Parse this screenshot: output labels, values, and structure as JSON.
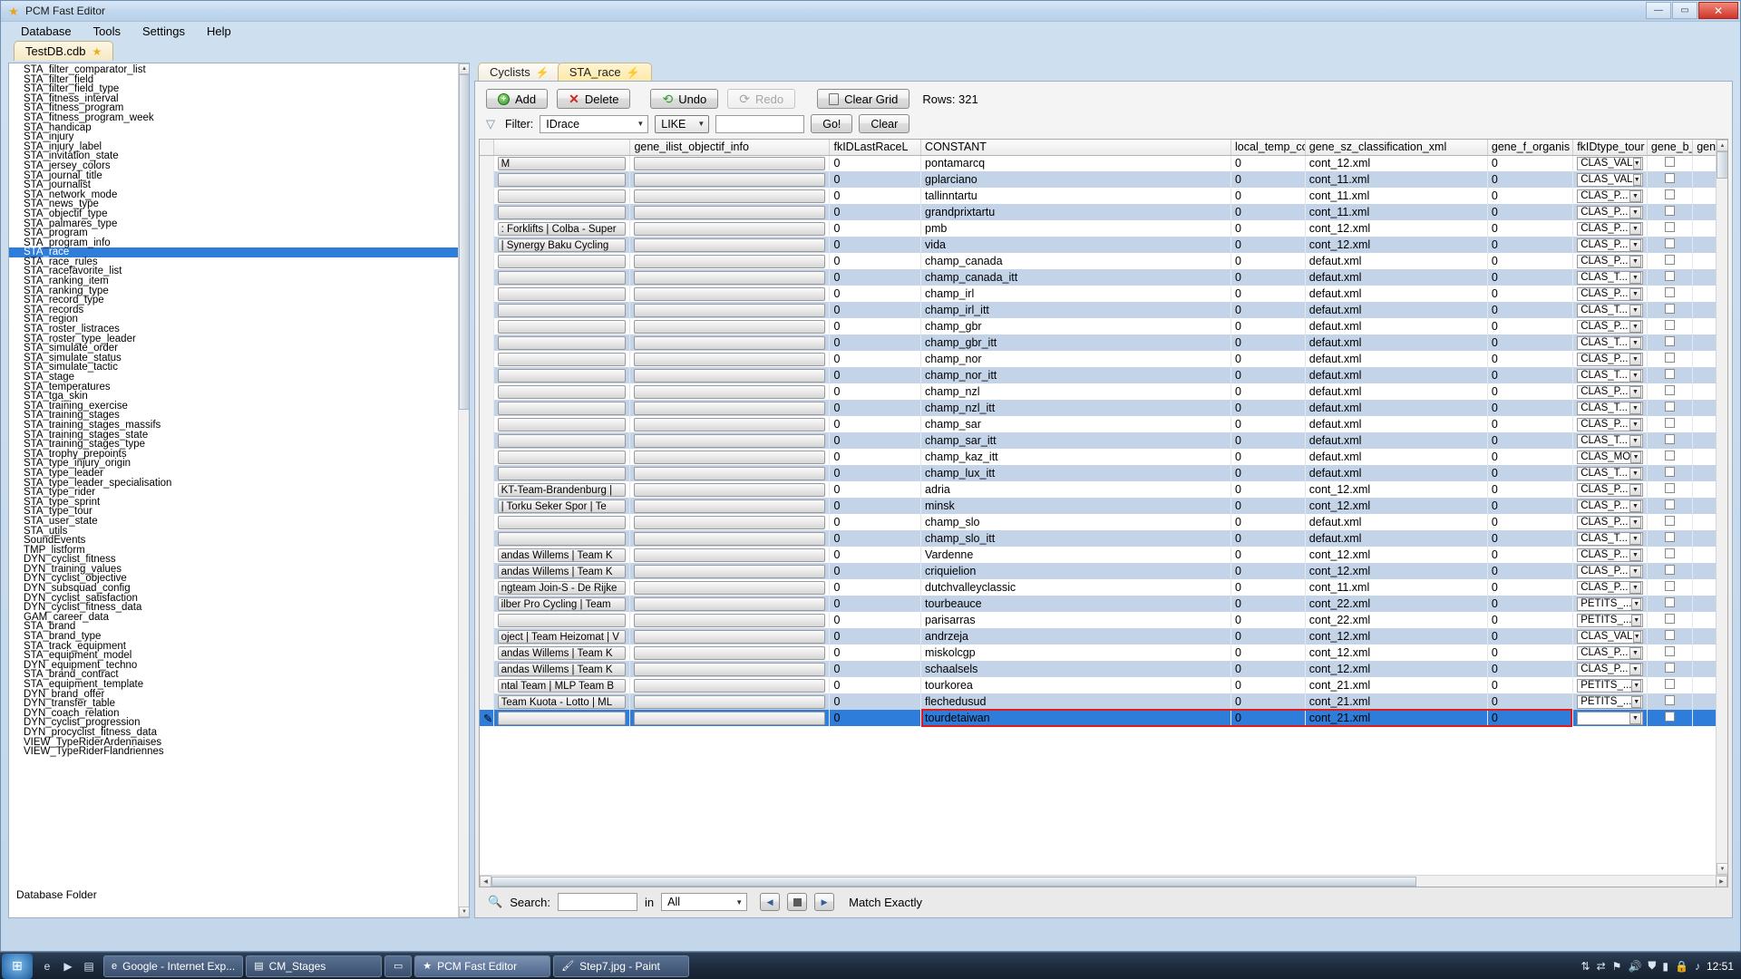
{
  "window": {
    "title": "PCM Fast Editor",
    "icon": "star-icon",
    "minimize": "—",
    "maximize": "▭",
    "close": "✕"
  },
  "menu": [
    "Database",
    "Tools",
    "Settings",
    "Help"
  ],
  "doc_tab": {
    "label": "TestDB.cdb",
    "icon": "star-icon"
  },
  "sidebar": {
    "items": [
      "STA_filter_comparator_list",
      "STA_filter_field",
      "STA_filter_field_type",
      "STA_fitness_interval",
      "STA_fitness_program",
      "STA_fitness_program_week",
      "STA_handicap",
      "STA_injury",
      "STA_injury_label",
      "STA_invitation_state",
      "STA_jersey_colors",
      "STA_journal_title",
      "STA_journalist",
      "STA_network_mode",
      "STA_news_type",
      "STA_objectif_type",
      "STA_palmares_type",
      "STA_program",
      "STA_program_info",
      "STA_race",
      "STA_race_rules",
      "STA_racefavorite_list",
      "STA_ranking_item",
      "STA_ranking_type",
      "STA_record_type",
      "STA_records",
      "STA_region",
      "STA_roster_listraces",
      "STA_roster_type_leader",
      "STA_simulate_order",
      "STA_simulate_status",
      "STA_simulate_tactic",
      "STA_stage",
      "STA_temperatures",
      "STA_tga_skin",
      "STA_training_exercise",
      "STA_training_stages",
      "STA_training_stages_massifs",
      "STA_training_stages_state",
      "STA_training_stages_type",
      "STA_trophy_prepoints",
      "STA_type_injury_origin",
      "STA_type_leader",
      "STA_type_leader_specialisation",
      "STA_type_rider",
      "STA_type_sprint",
      "STA_type_tour",
      "STA_user_state",
      "STA_utils",
      "SoundEvents",
      "TMP_listform",
      "DYN_cyclist_fitness",
      "DYN_training_values",
      "DYN_cyclist_objective",
      "DYN_subsquad_config",
      "DYN_cyclist_satisfaction",
      "DYN_cyclist_fitness_data",
      "GAM_career_data",
      "STA_brand",
      "STA_brand_type",
      "STA_track_equipment",
      "STA_equipment_model",
      "DYN_equipment_techno",
      "STA_brand_contract",
      "STA_equipment_template",
      "DYN_brand_offer",
      "DYN_transfer_table",
      "DYN_coach_relation",
      "DYN_cyclist_progression",
      "DYN_procyclist_fitness_data",
      "VIEW_TypeRiderArdennaises",
      "VIEW_TypeRiderFlandriennes"
    ],
    "selected": "STA_race",
    "bottom_label": "Database Folder"
  },
  "grid_tabs": [
    {
      "label": "Cyclists",
      "active": false,
      "icon": "lightning-icon"
    },
    {
      "label": "STA_race",
      "active": true,
      "icon": "lightning-icon"
    }
  ],
  "toolbar": {
    "add_label": "Add",
    "delete_label": "Delete",
    "undo_label": "Undo",
    "redo_label": "Redo",
    "clear_grid_label": "Clear Grid",
    "rows_label": "Rows: 321"
  },
  "filter": {
    "label": "Filter:",
    "field_value": "IDrace",
    "operator_value": "LIKE",
    "value": "",
    "go_label": "Go!",
    "clear_label": "Clear"
  },
  "grid": {
    "columns": [
      "",
      "",
      "gene_ilist_objectif_info",
      "fkIDLastRaceL",
      "CONSTANT",
      "local_temp_cou",
      "gene_sz_classification_xml",
      "gene_f_organis",
      "fkIDtype_tour",
      "gene_b_ForceI",
      "gen"
    ],
    "rows": [
      {
        "c0": "M",
        "c1": "",
        "fk": "0",
        "constant": "pontamarcq",
        "temp": "0",
        "xml": "cont_12.xml",
        "org": "0",
        "tour": "CLAS_VAL",
        "alt": false
      },
      {
        "c0": "",
        "c1": "",
        "fk": "0",
        "constant": "gplarciano",
        "temp": "0",
        "xml": "cont_11.xml",
        "org": "0",
        "tour": "CLAS_VAL",
        "alt": true
      },
      {
        "c0": "",
        "c1": "",
        "fk": "0",
        "constant": "tallinntartu",
        "temp": "0",
        "xml": "cont_11.xml",
        "org": "0",
        "tour": "CLAS_P...",
        "alt": false
      },
      {
        "c0": "",
        "c1": "",
        "fk": "0",
        "constant": "grandprixtartu",
        "temp": "0",
        "xml": "cont_11.xml",
        "org": "0",
        "tour": "CLAS_P...",
        "alt": true
      },
      {
        "c0": ": Forklifts | Colba - Super",
        "c1": "",
        "fk": "0",
        "constant": "pmb",
        "temp": "0",
        "xml": "cont_12.xml",
        "org": "0",
        "tour": "CLAS_P...",
        "alt": false
      },
      {
        "c0": "| Synergy Baku Cycling",
        "c1": "",
        "fk": "0",
        "constant": "vida",
        "temp": "0",
        "xml": "cont_12.xml",
        "org": "0",
        "tour": "CLAS_P...",
        "alt": true
      },
      {
        "c0": "",
        "c1": "",
        "fk": "0",
        "constant": "champ_canada",
        "temp": "0",
        "xml": "defaut.xml",
        "org": "0",
        "tour": "CLAS_P...",
        "alt": false
      },
      {
        "c0": "",
        "c1": "",
        "fk": "0",
        "constant": "champ_canada_itt",
        "temp": "0",
        "xml": "defaut.xml",
        "org": "0",
        "tour": "CLAS_T...",
        "alt": true
      },
      {
        "c0": "",
        "c1": "",
        "fk": "0",
        "constant": "champ_irl",
        "temp": "0",
        "xml": "defaut.xml",
        "org": "0",
        "tour": "CLAS_P...",
        "alt": false
      },
      {
        "c0": "",
        "c1": "",
        "fk": "0",
        "constant": "champ_irl_itt",
        "temp": "0",
        "xml": "defaut.xml",
        "org": "0",
        "tour": "CLAS_T...",
        "alt": true
      },
      {
        "c0": "",
        "c1": "",
        "fk": "0",
        "constant": "champ_gbr",
        "temp": "0",
        "xml": "defaut.xml",
        "org": "0",
        "tour": "CLAS_P...",
        "alt": false
      },
      {
        "c0": "",
        "c1": "",
        "fk": "0",
        "constant": "champ_gbr_itt",
        "temp": "0",
        "xml": "defaut.xml",
        "org": "0",
        "tour": "CLAS_T...",
        "alt": true
      },
      {
        "c0": "",
        "c1": "",
        "fk": "0",
        "constant": "champ_nor",
        "temp": "0",
        "xml": "defaut.xml",
        "org": "0",
        "tour": "CLAS_P...",
        "alt": false
      },
      {
        "c0": "",
        "c1": "",
        "fk": "0",
        "constant": "champ_nor_itt",
        "temp": "0",
        "xml": "defaut.xml",
        "org": "0",
        "tour": "CLAS_T...",
        "alt": true
      },
      {
        "c0": "",
        "c1": "",
        "fk": "0",
        "constant": "champ_nzl",
        "temp": "0",
        "xml": "defaut.xml",
        "org": "0",
        "tour": "CLAS_P...",
        "alt": false
      },
      {
        "c0": "",
        "c1": "",
        "fk": "0",
        "constant": "champ_nzl_itt",
        "temp": "0",
        "xml": "defaut.xml",
        "org": "0",
        "tour": "CLAS_T...",
        "alt": true
      },
      {
        "c0": "",
        "c1": "",
        "fk": "0",
        "constant": "champ_sar",
        "temp": "0",
        "xml": "defaut.xml",
        "org": "0",
        "tour": "CLAS_P...",
        "alt": false
      },
      {
        "c0": "",
        "c1": "",
        "fk": "0",
        "constant": "champ_sar_itt",
        "temp": "0",
        "xml": "defaut.xml",
        "org": "0",
        "tour": "CLAS_T...",
        "alt": true
      },
      {
        "c0": "",
        "c1": "",
        "fk": "0",
        "constant": "champ_kaz_itt",
        "temp": "0",
        "xml": "defaut.xml",
        "org": "0",
        "tour": "CLAS_MO",
        "alt": false
      },
      {
        "c0": "",
        "c1": "",
        "fk": "0",
        "constant": "champ_lux_itt",
        "temp": "0",
        "xml": "defaut.xml",
        "org": "0",
        "tour": "CLAS_T...",
        "alt": true
      },
      {
        "c0": "KT-Team-Brandenburg |",
        "c1": "",
        "fk": "0",
        "constant": "adria",
        "temp": "0",
        "xml": "cont_12.xml",
        "org": "0",
        "tour": "CLAS_P...",
        "alt": false
      },
      {
        "c0": "| Torku Seker Spor | Te",
        "c1": "",
        "fk": "0",
        "constant": "minsk",
        "temp": "0",
        "xml": "cont_12.xml",
        "org": "0",
        "tour": "CLAS_P...",
        "alt": true
      },
      {
        "c0": "",
        "c1": "",
        "fk": "0",
        "constant": "champ_slo",
        "temp": "0",
        "xml": "defaut.xml",
        "org": "0",
        "tour": "CLAS_P...",
        "alt": false
      },
      {
        "c0": "",
        "c1": "",
        "fk": "0",
        "constant": "champ_slo_itt",
        "temp": "0",
        "xml": "defaut.xml",
        "org": "0",
        "tour": "CLAS_T...",
        "alt": true
      },
      {
        "c0": "andas Willems | Team K",
        "c1": "",
        "fk": "0",
        "constant": "Vardenne",
        "temp": "0",
        "xml": "cont_12.xml",
        "org": "0",
        "tour": "CLAS_P...",
        "alt": false
      },
      {
        "c0": "andas Willems | Team K",
        "c1": "",
        "fk": "0",
        "constant": "criquielion",
        "temp": "0",
        "xml": "cont_12.xml",
        "org": "0",
        "tour": "CLAS_P...",
        "alt": true
      },
      {
        "c0": "ngteam Join-S - De Rijke",
        "c1": "",
        "fk": "0",
        "constant": "dutchvalleyclassic",
        "temp": "0",
        "xml": "cont_11.xml",
        "org": "0",
        "tour": "CLAS_P...",
        "alt": false
      },
      {
        "c0": "ilber Pro Cycling | Team",
        "c1": "",
        "fk": "0",
        "constant": "tourbeauce",
        "temp": "0",
        "xml": "cont_22.xml",
        "org": "0",
        "tour": "PETITS_...",
        "alt": true
      },
      {
        "c0": "",
        "c1": "",
        "fk": "0",
        "constant": "parisarras",
        "temp": "0",
        "xml": "cont_22.xml",
        "org": "0",
        "tour": "PETITS_...",
        "alt": false
      },
      {
        "c0": "oject | Team Heizomat | V",
        "c1": "",
        "fk": "0",
        "constant": "andrzeja",
        "temp": "0",
        "xml": "cont_12.xml",
        "org": "0",
        "tour": "CLAS_VAL",
        "alt": true
      },
      {
        "c0": "andas Willems | Team K",
        "c1": "",
        "fk": "0",
        "constant": "miskolcgp",
        "temp": "0",
        "xml": "cont_12.xml",
        "org": "0",
        "tour": "CLAS_P...",
        "alt": false
      },
      {
        "c0": "andas Willems | Team K",
        "c1": "",
        "fk": "0",
        "constant": "schaalsels",
        "temp": "0",
        "xml": "cont_12.xml",
        "org": "0",
        "tour": "CLAS_P...",
        "alt": true
      },
      {
        "c0": "ntal Team | MLP Team B",
        "c1": "",
        "fk": "0",
        "constant": "tourkorea",
        "temp": "0",
        "xml": "cont_21.xml",
        "org": "0",
        "tour": "PETITS_...",
        "alt": false
      },
      {
        "c0": "Team Kuota - Lotto | ML",
        "c1": "",
        "fk": "0",
        "constant": "flechedusud",
        "temp": "0",
        "xml": "cont_21.xml",
        "org": "0",
        "tour": "PETITS_...",
        "alt": true
      },
      {
        "c0": "",
        "c1": "",
        "fk": "0",
        "constant": "tourdetaiwan",
        "temp": "0",
        "xml": "cont_21.xml",
        "org": "0",
        "tour": "",
        "alt": false,
        "selected": true
      }
    ]
  },
  "search": {
    "label": "Search:",
    "value": "",
    "in_label": "in",
    "scope_value": "All",
    "match_exactly_label": "Match Exactly",
    "prev_icon": "prev-arrow-icon",
    "stop_icon": "stop-icon",
    "next_icon": "next-arrow-icon"
  },
  "taskbar": {
    "start_icon": "windows-start-icon",
    "quick_icons": [
      "internet-explorer-icon",
      "media-player-icon",
      "folder-icon"
    ],
    "items": [
      {
        "label": "Google - Internet Exp...",
        "icon": "ie-icon",
        "active": false
      },
      {
        "label": "CM_Stages",
        "icon": "folder-icon",
        "active": false
      },
      {
        "label": "",
        "icon": "window-icon",
        "active": false
      },
      {
        "label": "PCM Fast Editor",
        "icon": "star-icon",
        "active": true
      },
      {
        "label": "Step7.jpg - Paint",
        "icon": "paint-icon",
        "active": false
      }
    ],
    "tray_icons": [
      "network-icon",
      "arrows-icon",
      "flag-icon",
      "volume-icon",
      "shield-icon",
      "battery-icon",
      "lock-icon",
      "media-icon"
    ],
    "clock": "12:51"
  },
  "colors": {
    "selection_blue": "#2f7ddb",
    "alt_row": "#c3d3e8",
    "highlight_red": "#e01b1b",
    "tab_yellow": "#ffe9a8"
  }
}
